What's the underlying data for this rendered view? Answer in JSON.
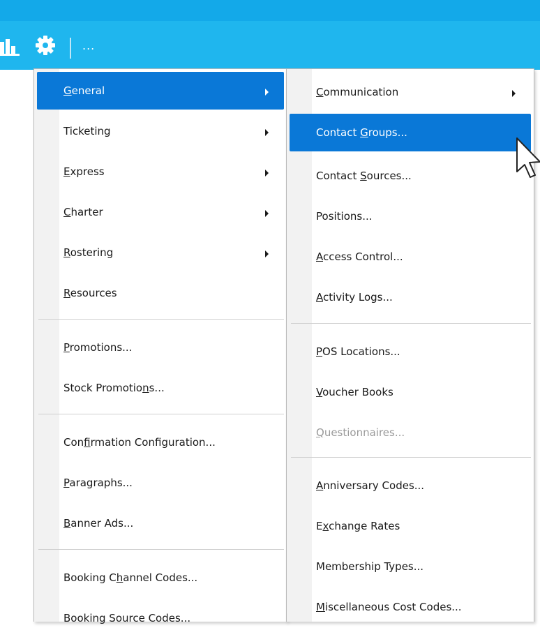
{
  "toolbar": {
    "more_label": "...",
    "icons": [
      "bar-chart-icon",
      "gear-icon"
    ],
    "background": "#1fb6ee"
  },
  "main_menu": {
    "items": [
      {
        "label": "General",
        "mnemonic_index": 0,
        "submenu": true,
        "active": true
      },
      {
        "label": "Ticketing",
        "mnemonic_index": -1,
        "submenu": true
      },
      {
        "label": "Express",
        "mnemonic_index": 0,
        "submenu": true
      },
      {
        "label": "Charter",
        "mnemonic_index": 0,
        "submenu": true
      },
      {
        "label": "Rostering",
        "mnemonic_index": 0,
        "submenu": true
      },
      {
        "label": "Resources",
        "mnemonic_index": 0
      },
      {
        "label": "Promotions...",
        "mnemonic_index": 0
      },
      {
        "label": "Stock Promotions...",
        "mnemonic_index": 14
      },
      {
        "label": "Confirmation Configuration...",
        "mnemonic_index": 3
      },
      {
        "label": "Paragraphs...",
        "mnemonic_index": 0
      },
      {
        "label": "Banner Ads...",
        "mnemonic_index": 0
      },
      {
        "label": "Booking Channel Codes...",
        "mnemonic_index": 9
      },
      {
        "label": "Booking Source Codes...",
        "mnemonic_index": -1
      }
    ]
  },
  "sub_menu": {
    "items": [
      {
        "label": "Communication",
        "mnemonic_index": 0,
        "submenu": true
      },
      {
        "label": "Contact Groups...",
        "mnemonic_index": 8,
        "active": true
      },
      {
        "label": "Contact Sources...",
        "mnemonic_index": 8
      },
      {
        "label": "Positions...",
        "mnemonic_index": -1
      },
      {
        "label": "Access Control...",
        "mnemonic_index": 0
      },
      {
        "label": "Activity Logs...",
        "mnemonic_index": 0
      },
      {
        "label": "POS Locations...",
        "mnemonic_index": 0
      },
      {
        "label": "Voucher Books",
        "mnemonic_index": 0
      },
      {
        "label": "Questionnaires...",
        "mnemonic_index": 0,
        "disabled": true
      },
      {
        "label": "Anniversary Codes...",
        "mnemonic_index": 0
      },
      {
        "label": "Exchange Rates",
        "mnemonic_index": 1
      },
      {
        "label": "Membership Types...",
        "mnemonic_index": -1
      },
      {
        "label": "Miscellaneous Cost Codes...",
        "mnemonic_index": 0
      }
    ]
  },
  "colors": {
    "highlight": "#0a78d7",
    "disabled_text": "#9a9a9a",
    "gutter": "#f2f2f2"
  }
}
